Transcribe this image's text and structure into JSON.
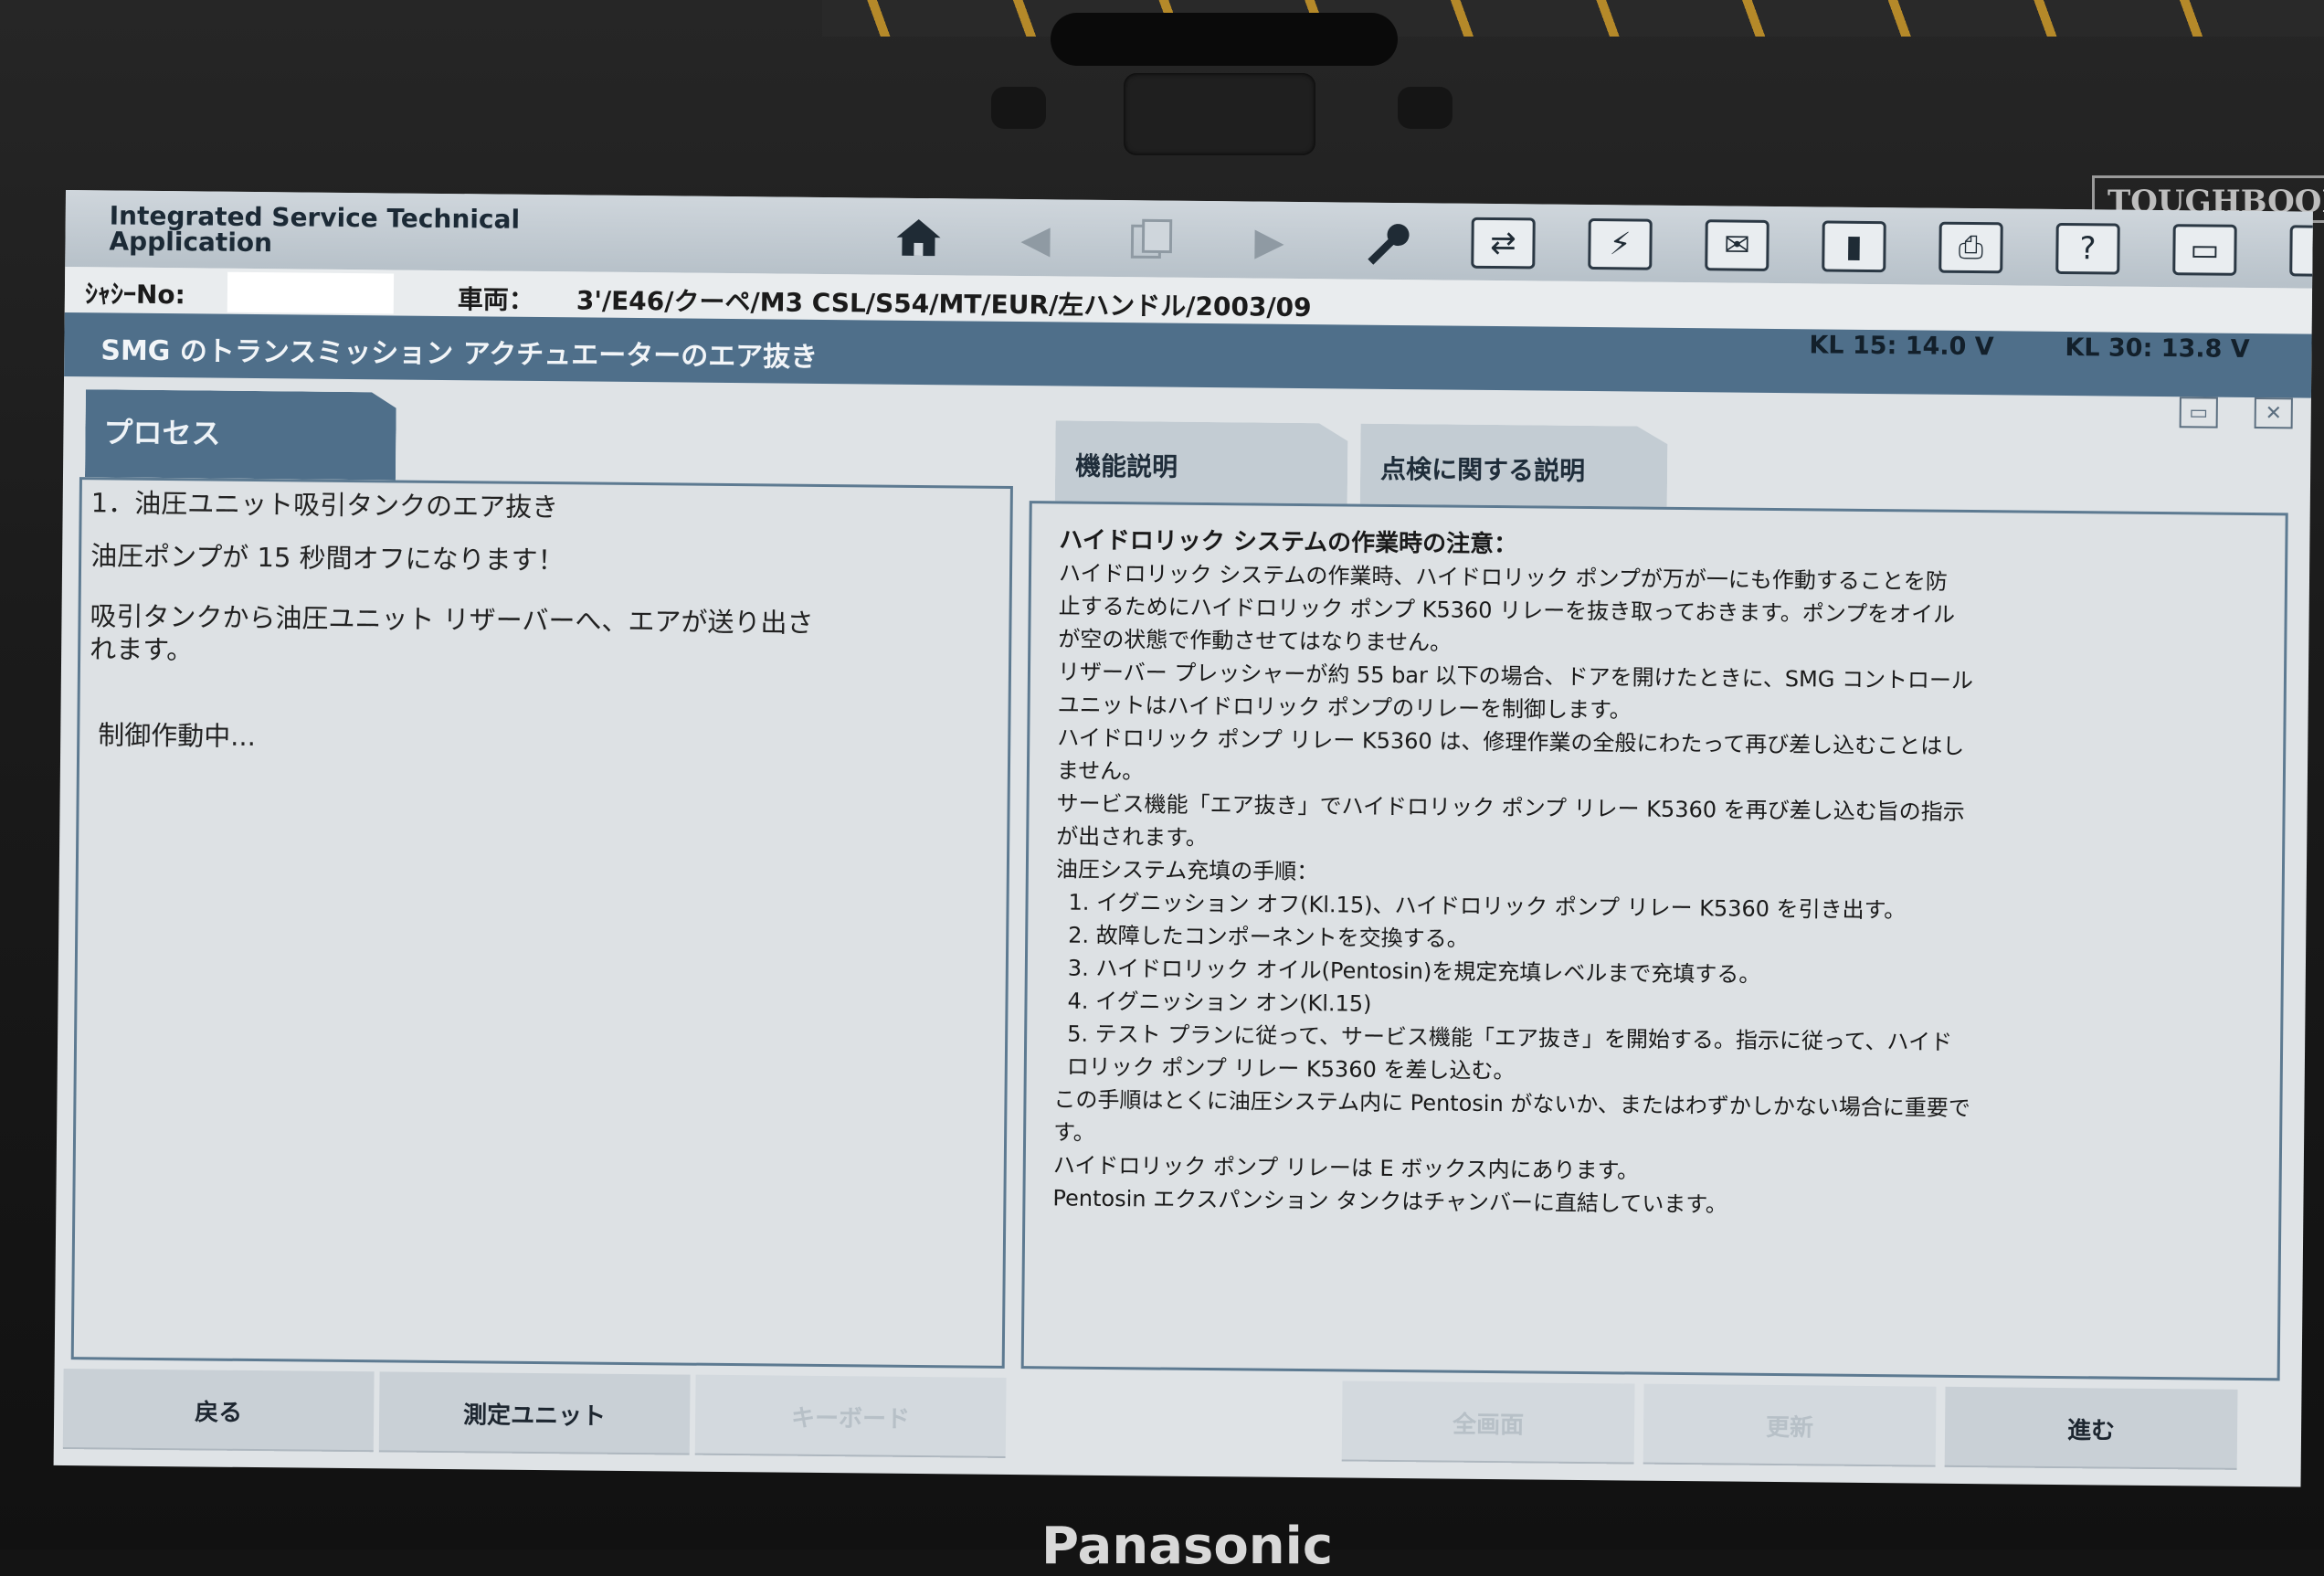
{
  "device": {
    "badge": "TOUGHBOOK",
    "maker": "Panasonic"
  },
  "app": {
    "title_line1": "Integrated Service Technical",
    "title_line2": "Application"
  },
  "toolbar": {
    "icons": [
      "home-icon",
      "arrow-left-icon",
      "pages-icon",
      "arrow-right-icon",
      "wrench-icon",
      "transfer-icon",
      "plug-icon",
      "mail-icon",
      "battery-icon",
      "printer-icon",
      "help-icon",
      "minimize-icon",
      "close-icon"
    ]
  },
  "info": {
    "chassis_label": "ｼｬｼｰNo:",
    "vehicle_label": "車両：",
    "vehicle_value": "3'/E46/クーペ/M3 CSL/S54/MT/EUR/左ハンドル/2003/09",
    "kl15": "KL 15:  14.0 V",
    "kl30": "KL 30:  13.8 V"
  },
  "window": {
    "title": "SMG のトランスミッション アクチュエーターのエア抜き"
  },
  "process": {
    "tab_label": "プロセス",
    "step_title": "1．油圧ユニット吸引タンクのエア抜き",
    "line1": "油圧ポンプが 15 秒間オフになります！",
    "line2a": "吸引タンクから油圧ユニット リザーバーへ、エアが送り出さ",
    "line2b": "れます。",
    "status": "制御作動中..."
  },
  "tabs": {
    "function_desc": "機能説明",
    "inspection_desc": "点検に関する説明"
  },
  "description": {
    "heading": "ハイドロリック システムの作業時の注意：",
    "p1a": "ハイドロリック システムの作業時、ハイドロリック ポンプが万が一にも作動することを防",
    "p1b": "止するためにハイドロリック ポンプ K5360 リレーを抜き取っておきます。ポンプをオイル",
    "p1c": "が空の状態で作動させてはなりません。",
    "p2a": "リザーバー プレッシャーが約 55 bar 以下の場合、ドアを開けたときに、SMG コントロール",
    "p2b": "ユニットはハイドロリック ポンプのリレーを制御します。",
    "p3a": "ハイドロリック ポンプ リレー K5360 は、修理作業の全般にわたって再び差し込むことはし",
    "p3b": "ません。",
    "p4a": "サービス機能「エア抜き」でハイドロリック ポンプ リレー K5360 を再び差し込む旨の指示",
    "p4b": "が出されます。",
    "procedure_title": "油圧システム充填の手順：",
    "s1": "1. イグニッション オフ(Kl.15)、ハイドロリック ポンプ リレー K5360 を引き出す。",
    "s2": "2. 故障したコンポーネントを交換する。",
    "s3": "3. ハイドロリック オイル(Pentosin)を規定充填レベルまで充填する。",
    "s4": "4. イグニッション オン(Kl.15)",
    "s5a": "5. テスト プランに従って、サービス機能「エア抜き」を開始する。指示に従って、ハイド",
    "s5b": "ロリック ポンプ リレー K5360 を差し込む。",
    "p5a": "この手順はとくに油圧システム内に Pentosin がないか、またはわずかしかない場合に重要で",
    "p5b": "す。",
    "p6": "ハイドロリック ポンプ リレーは E ボックス内にあります。",
    "p7": "Pentosin エクスパンション タンクはチャンバーに直結しています。"
  },
  "buttons": {
    "back": "戻る",
    "measure_unit": "測定ユニット",
    "keyboard": "キーボード",
    "fullscreen": "全画面",
    "update": "更新",
    "next": "進む"
  }
}
